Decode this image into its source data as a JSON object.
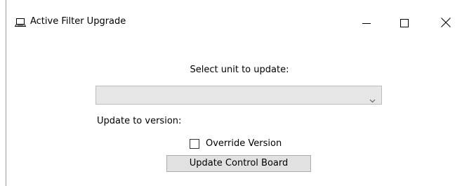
{
  "window": {
    "title": "Active Filter Upgrade",
    "app_icon": "laptop-icon",
    "controls": {
      "minimize_icon": "minimize-icon",
      "maximize_icon": "maximize-icon",
      "close_icon": "close-icon"
    }
  },
  "form": {
    "select_unit_label": "Select unit to update:",
    "unit_dropdown": {
      "value": "",
      "arrow_icon": "chevron-down-icon"
    },
    "update_version_label": "Update to version:",
    "update_version_value": "",
    "override_checkbox": {
      "label": "Override Version",
      "checked": false
    },
    "update_button_label": "Update Control Board"
  },
  "colors": {
    "window_background": "#ffffff",
    "dropdown_background": "#e6e6e6",
    "dropdown_border": "#bcbcbc",
    "button_background": "#e1e1e1",
    "button_border": "#adadad",
    "text": "#000000"
  }
}
